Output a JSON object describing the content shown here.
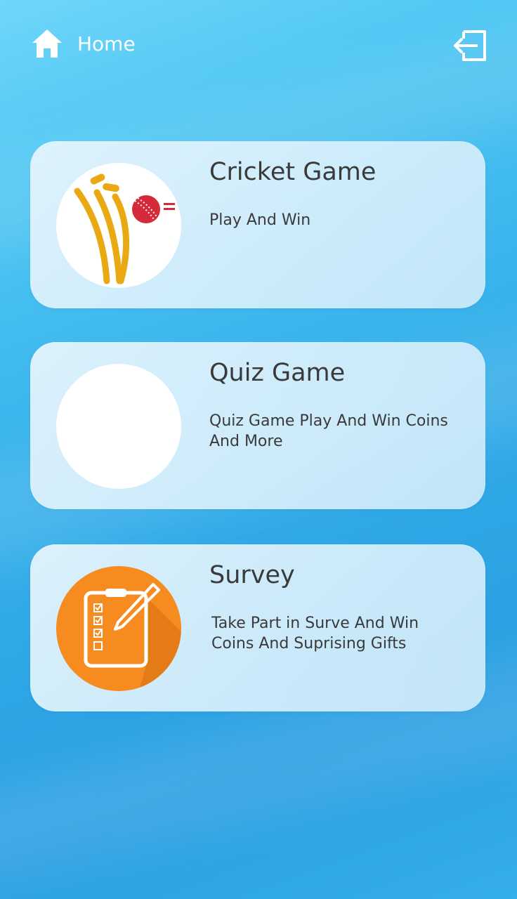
{
  "header": {
    "title": "Home",
    "home_icon": "home-icon",
    "logout_icon": "logout-icon"
  },
  "cards": [
    {
      "title": "Cricket Game",
      "description": "Play And Win",
      "icon": "cricket-wicket-icon"
    },
    {
      "title": "Quiz Game",
      "description": "Quiz Game Play And Win Coins And More",
      "icon": "quiz-icon"
    },
    {
      "title": "Survey",
      "description": "Take Part in Surve And Win Coins And Suprising Gifts",
      "icon": "survey-clipboard-icon"
    }
  ],
  "colors": {
    "background": "#3bb5ec",
    "card_background": "#dff2fc",
    "text": "#3a3a3a",
    "wicket": "#e8a912",
    "ball": "#d42a3a",
    "survey_circle": "#f68b1f"
  }
}
